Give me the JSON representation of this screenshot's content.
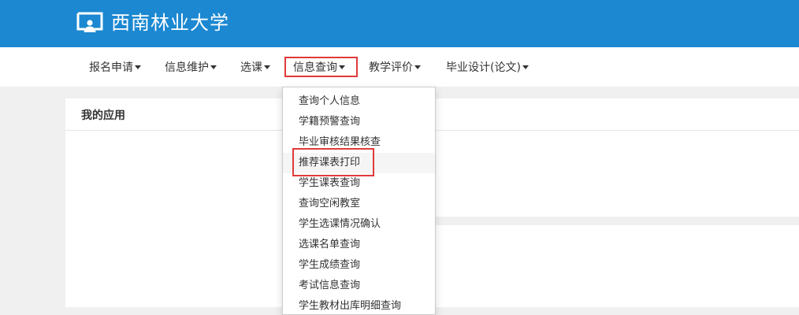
{
  "header": {
    "site_name": "西南林业大学",
    "logo_icon": "monitor-person-icon",
    "background_color": "#1b88d1"
  },
  "nav": {
    "items": [
      {
        "label": "报名申请"
      },
      {
        "label": "信息维护"
      },
      {
        "label": "选课"
      },
      {
        "label": "信息查询"
      },
      {
        "label": "教学评价"
      },
      {
        "label": "毕业设计(论文)"
      }
    ],
    "active_index": 3,
    "highlight_color": "#e03a3a"
  },
  "panel": {
    "title": "我的应用"
  },
  "dropdown": {
    "items": [
      {
        "label": "查询个人信息"
      },
      {
        "label": "学籍预警查询"
      },
      {
        "label": "毕业审核结果核查"
      },
      {
        "label": "推荐课表打印"
      },
      {
        "label": "学生课表查询"
      },
      {
        "label": "查询空闲教室"
      },
      {
        "label": "学生选课情况确认"
      },
      {
        "label": "选课名单查询"
      },
      {
        "label": "学生成绩查询"
      },
      {
        "label": "考试信息查询"
      },
      {
        "label": "学生教材出库明细查询"
      }
    ],
    "hovered_index": 3
  }
}
